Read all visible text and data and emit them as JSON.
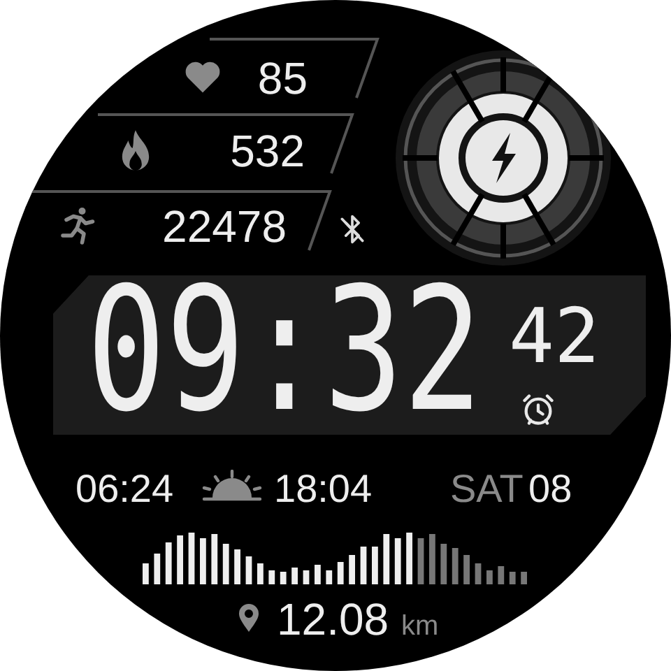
{
  "metrics": [
    {
      "kind": "heart_rate",
      "value": "85"
    },
    {
      "kind": "calories",
      "value": "532"
    },
    {
      "kind": "steps",
      "value": "22478"
    }
  ],
  "bluetooth_connected": false,
  "time": "09:32",
  "seconds": "42",
  "alarm_set": true,
  "sunrise": "06:24",
  "sunset": "18:04",
  "weekday": "SAT",
  "day": "08",
  "distance": {
    "value": "12.08",
    "unit": "km"
  }
}
